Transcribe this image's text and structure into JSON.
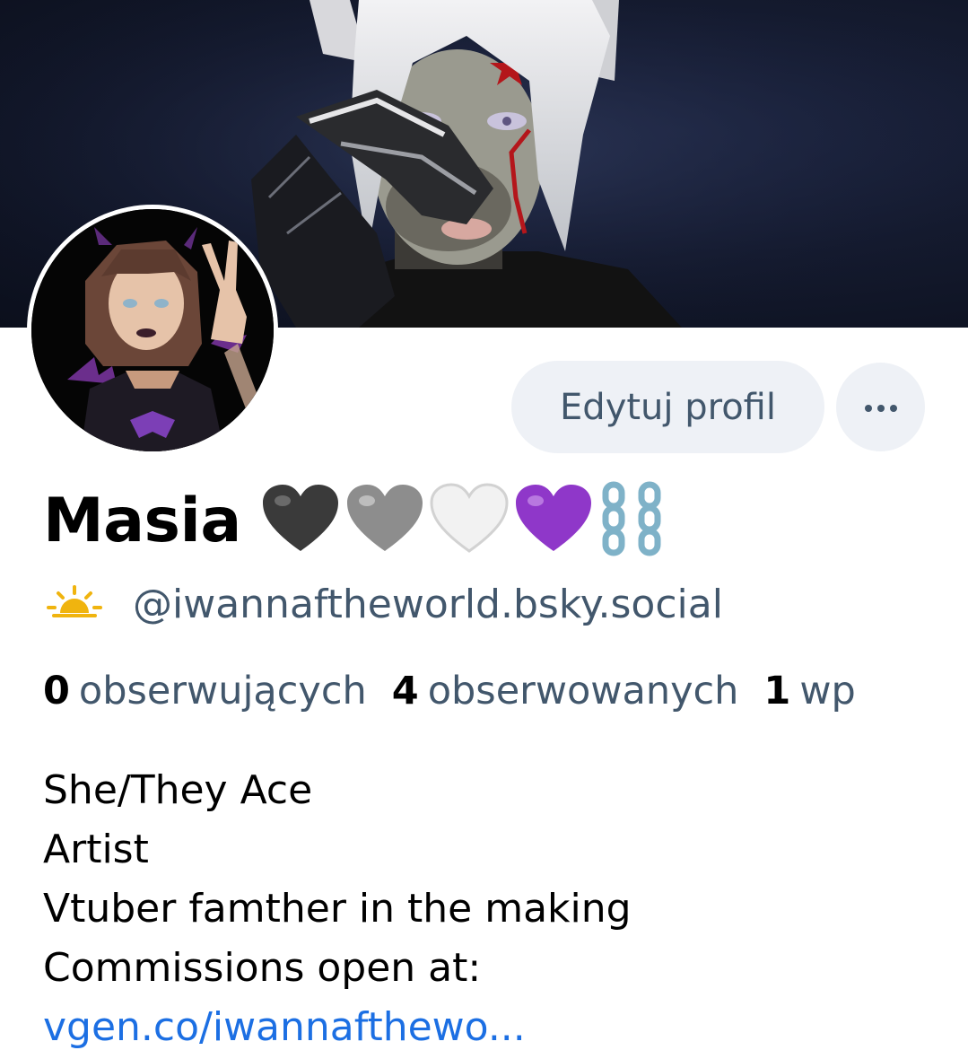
{
  "profile": {
    "display_name": "Masia",
    "name_emojis": [
      "🖤",
      "🩶",
      "🤍",
      "💜",
      "⛓️"
    ],
    "status_emoji": "weather-sun-behind-cloud-icon",
    "handle": "@iwannaftheworld.bsky.social",
    "stats": [
      {
        "count": "0",
        "label": "obserwujących"
      },
      {
        "count": "4",
        "label": "obserwowanych"
      },
      {
        "count": "1",
        "label": "wp"
      }
    ],
    "bio_lines": [
      "She/They Ace",
      "Artist",
      "Vtuber famther in the making",
      "Commissions open at:"
    ],
    "bio_link": "vgen.co/iwannafthewo..."
  },
  "actions": {
    "edit_label": "Edytuj profil"
  },
  "colors": {
    "accent_link": "#1c6fe3",
    "muted_text": "#42576c",
    "button_bg": "#eef1f6"
  }
}
